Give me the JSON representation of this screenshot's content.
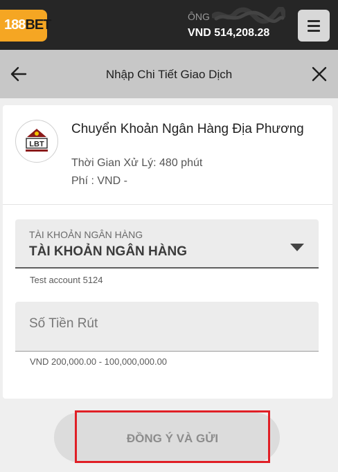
{
  "header": {
    "logo_number": "188",
    "logo_word": "BET",
    "user_prefix": "ÔNG",
    "balance": "VND 514,208.28",
    "menu_icon": "hamburger-icon",
    "brand_color": "#f5a623"
  },
  "subheader": {
    "back_icon": "arrow-left-icon",
    "title": "Nhập Chi Tiết Giao Dịch",
    "close_icon": "close-icon"
  },
  "method": {
    "logo_icon": "lbt-bank-icon",
    "logo_text": "LBT",
    "title": "Chuyển Khoản Ngân Hàng Địa Phương",
    "processing_time": "Thời Gian Xử Lý: 480 phút",
    "fee": "Phí : VND -"
  },
  "form": {
    "bank_account": {
      "label": "TÀI KHOẢN NGÂN HÀNG",
      "value": "TÀI KHOẢN NGÂN HÀNG",
      "hint": "Test account 5124",
      "icon": "caret-down-icon"
    },
    "amount": {
      "placeholder": "Số Tiền Rút",
      "value": "",
      "hint": "VND 200,000.00 - 100,000,000.00"
    },
    "submit_label": "ĐỒNG Ý VÀ GỬI",
    "highlight_color": "#e01f26"
  }
}
